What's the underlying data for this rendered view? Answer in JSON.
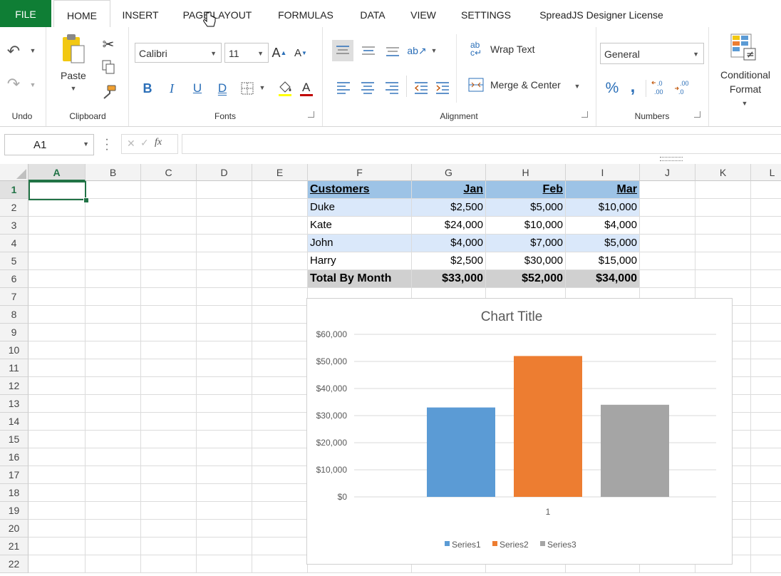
{
  "ribbon": {
    "tabs": [
      "FILE",
      "HOME",
      "INSERT",
      "PAGE LAYOUT",
      "FORMULAS",
      "DATA",
      "VIEW",
      "SETTINGS",
      "SpreadJS Designer License"
    ],
    "groups": {
      "undo": "Undo",
      "clipboard": "Clipboard",
      "fonts": "Fonts",
      "alignment": "Alignment",
      "numbers": "Numbers"
    },
    "paste_label": "Paste",
    "font_name": "Calibri",
    "font_size": "11",
    "wrap_text": "Wrap Text",
    "merge_center": "Merge & Center",
    "number_format": "General",
    "conditional_format_line1": "Conditional",
    "conditional_format_line2": "Format",
    "percent_symbol": "%",
    "comma_symbol": ","
  },
  "formula_bar": {
    "name_box": "A1",
    "fx": "fx",
    "formula": ""
  },
  "grid": {
    "columns": [
      "A",
      "B",
      "C",
      "D",
      "E",
      "F",
      "G",
      "H",
      "I",
      "J",
      "K",
      "L"
    ],
    "rows": [
      "1",
      "2",
      "3",
      "4",
      "5",
      "6",
      "7",
      "8",
      "9",
      "10",
      "11",
      "12",
      "13",
      "14",
      "15",
      "16",
      "17",
      "18",
      "19",
      "20",
      "21",
      "22"
    ],
    "selected_cell": "A1",
    "table": {
      "header": [
        "Customers",
        "Jan",
        "Feb",
        "Mar"
      ],
      "rows": [
        [
          "Duke",
          "$2,500",
          "$5,000",
          "$10,000"
        ],
        [
          "Kate",
          "$24,000",
          "$10,000",
          "$4,000"
        ],
        [
          "John",
          "$4,000",
          "$7,000",
          "$5,000"
        ],
        [
          "Harry",
          "$2,500",
          "$30,000",
          "$15,000"
        ]
      ],
      "total": [
        "Total By Month",
        "$33,000",
        "$52,000",
        "$34,000"
      ]
    }
  },
  "colors": {
    "accent": "#217346",
    "file_tab": "#0f7e35",
    "table_header": "#9dc3e6",
    "table_band": "#dae8fa",
    "table_total": "#d0d0d0"
  },
  "chart_data": {
    "type": "bar",
    "title": "Chart Title",
    "categories": [
      "1"
    ],
    "series": [
      {
        "name": "Series1",
        "values": [
          33000
        ],
        "color": "#5b9bd5"
      },
      {
        "name": "Series2",
        "values": [
          52000
        ],
        "color": "#ed7d31"
      },
      {
        "name": "Series3",
        "values": [
          34000
        ],
        "color": "#a5a5a5"
      }
    ],
    "y_ticks": [
      "$0",
      "$10,000",
      "$20,000",
      "$30,000",
      "$40,000",
      "$50,000",
      "$60,000"
    ],
    "ylim": [
      0,
      60000
    ],
    "grid": true,
    "legend": "bottom"
  }
}
